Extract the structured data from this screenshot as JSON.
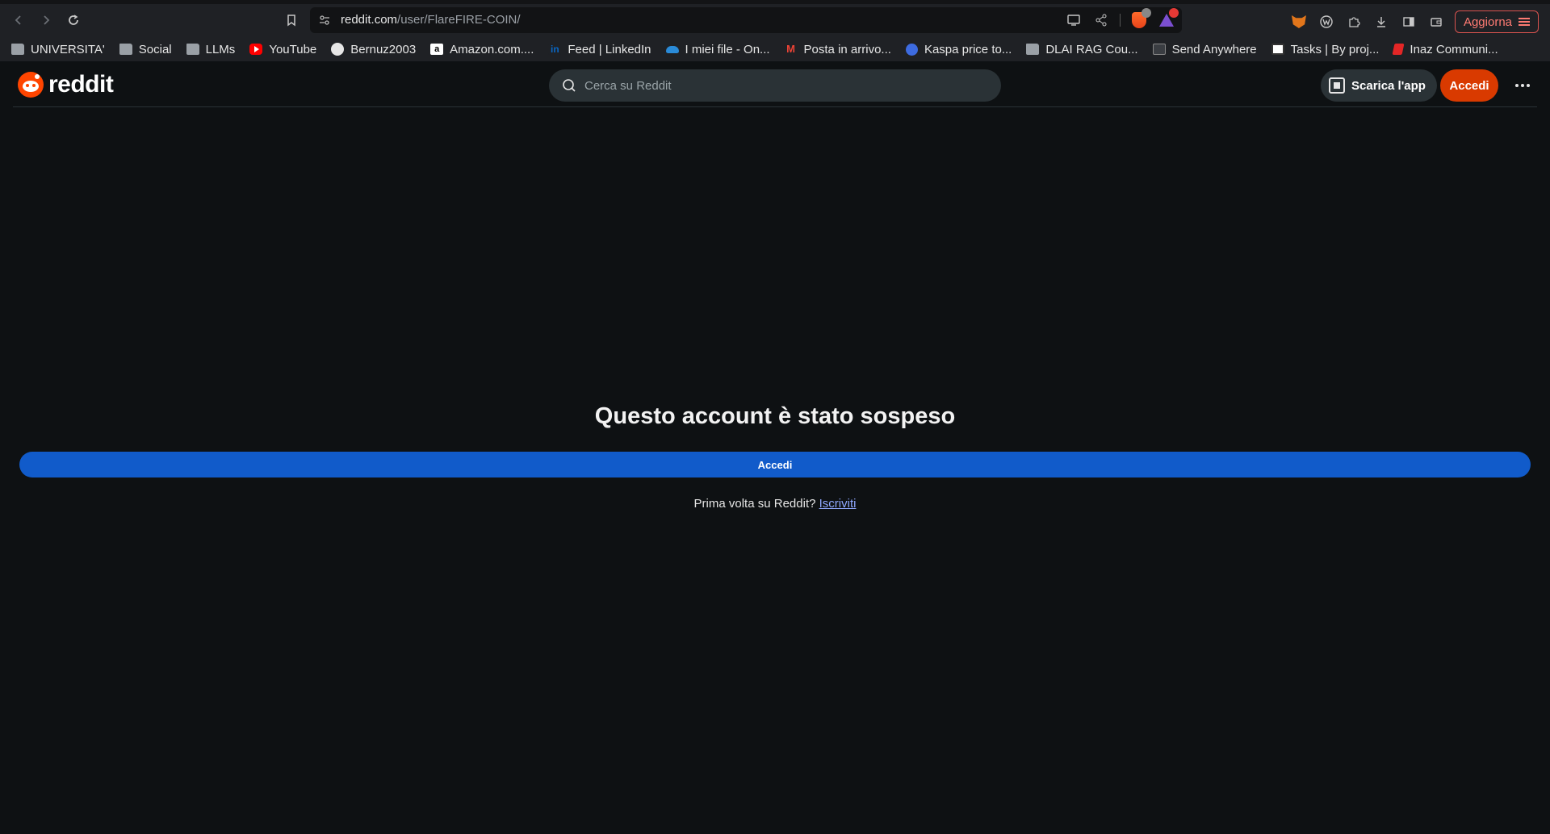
{
  "browser": {
    "url_host": "reddit.com",
    "url_path": "/user/FlareFIRE-COIN/",
    "update_label": "Aggiorna",
    "brave_shield_count": "",
    "rewards_badge": ""
  },
  "bookmarks": [
    {
      "label": "UNIVERSITA'",
      "icon": "folder-icon"
    },
    {
      "label": "Social",
      "icon": "folder-icon"
    },
    {
      "label": "LLMs",
      "icon": "folder-icon"
    },
    {
      "label": "YouTube",
      "icon": "youtube-icon"
    },
    {
      "label": "Bernuz2003",
      "icon": "github-icon"
    },
    {
      "label": "Amazon.com....",
      "icon": "amazon-icon"
    },
    {
      "label": "Feed | LinkedIn",
      "icon": "linkedin-icon"
    },
    {
      "label": "I miei file - On...",
      "icon": "onedrive-icon"
    },
    {
      "label": "Posta in arrivo...",
      "icon": "gmail-icon"
    },
    {
      "label": "Kaspa price to...",
      "icon": "kaspa-icon"
    },
    {
      "label": "DLAI RAG Cou...",
      "icon": "folder-icon"
    },
    {
      "label": "Send Anywhere",
      "icon": "send-anywhere-icon"
    },
    {
      "label": "Tasks | By proj...",
      "icon": "notion-icon"
    },
    {
      "label": "Inaz Communi...",
      "icon": "inaz-icon"
    }
  ],
  "reddit": {
    "logo_text": "reddit",
    "search_placeholder": "Cerca su Reddit",
    "get_app_label": "Scarica l'app",
    "login_label": "Accedi",
    "suspended_message": "Questo account è stato sospeso",
    "main_login_label": "Accedi",
    "signup_prompt": "Prima volta su Reddit?",
    "signup_link": "Iscriviti"
  },
  "colors": {
    "page_bg": "#0e1113",
    "reddit_orange": "#d93a00",
    "primary_blue": "#115bca",
    "link_color": "#8fa8ff"
  }
}
